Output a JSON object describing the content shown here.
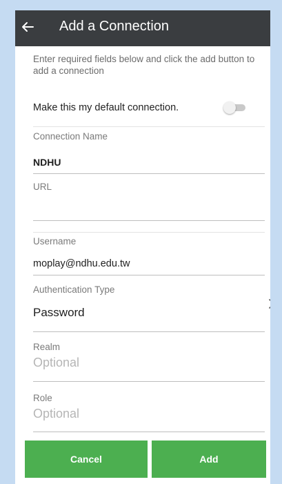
{
  "appbar": {
    "title": "Add a Connection",
    "back_icon": "arrow-left-icon"
  },
  "intro_text": "Enter required fields below and click the add button to add a connection",
  "default_toggle": {
    "label": "Make this my default connection.",
    "state": "off"
  },
  "fields": {
    "connection_name": {
      "label": "Connection Name",
      "value": "NDHU"
    },
    "url": {
      "label": "URL",
      "value": ""
    },
    "username": {
      "label": "Username",
      "value": "moplay@ndhu.edu.tw"
    },
    "auth_type": {
      "label": "Authentication Type",
      "value": "Password",
      "chevron_icon": "chevron-right-icon"
    },
    "realm": {
      "label": "Realm",
      "placeholder": "Optional"
    },
    "role": {
      "label": "Role",
      "placeholder": "Optional"
    }
  },
  "buttons": {
    "cancel": "Cancel",
    "add": "Add"
  },
  "colors": {
    "background": "#c5dbf2",
    "appbar": "#3a3d40",
    "button": "#4caf50"
  }
}
